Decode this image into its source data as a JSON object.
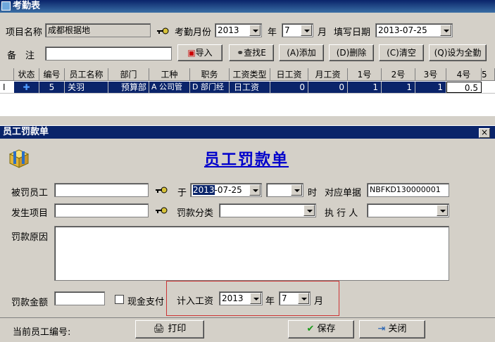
{
  "top": {
    "title": "考勤表",
    "project_label": "项目名称",
    "project_value": "成都根据地",
    "month_label": "考勤月份",
    "year_value": "2013",
    "year_unit": "年",
    "month_value": "7",
    "month_unit": "月",
    "fill_date_label": "填写日期",
    "fill_date_value": "2013-07-25",
    "remark_label": "备　注",
    "buttons": {
      "import": "导入",
      "search": "查找E",
      "add": "(A)添加",
      "delete": "(D)删除",
      "clear": "(C)清空",
      "set_all": "(Q)设为全勤"
    },
    "grid": {
      "headers": [
        "状态",
        "编号",
        "员工名称",
        "部门",
        "工种",
        "职务",
        "工资类型",
        "日工资",
        "月工资",
        "1号",
        "2号",
        "3号",
        "4号",
        "5"
      ],
      "row": {
        "indicator": "I",
        "status_icon": "plus-icon",
        "id": "5",
        "name": "关羽",
        "dept": "预算部",
        "job": "A 公司管",
        "position": "D 部门经",
        "salary_type": "日工资",
        "daily": "0",
        "monthly": "0",
        "d1": "1",
        "d2": "1",
        "d3": "1",
        "d4": "0.5"
      }
    }
  },
  "dialog": {
    "title": "员工罚款单",
    "close": "×",
    "heading": "员工罚款单",
    "employee_label": "被罚员工",
    "at_label": "于",
    "date_year_sel": "2013",
    "date_rest": "-07-25",
    "hour_label": "时",
    "doc_no_label": "对应单据",
    "doc_no_value": "NBFKD130000001",
    "item_label": "发生项目",
    "category_label": "罚款分类",
    "executor_label": "执 行 人",
    "reason_label": "罚款原因",
    "amount_label": "罚款金额",
    "cash_label": "现金支付",
    "salary_label": "计入工资",
    "salary_year": "2013",
    "year_unit": "年",
    "salary_month": "7",
    "month_unit": "月",
    "current_emp_label": "当前员工编号:",
    "print_btn": "打印",
    "save_btn": "保存",
    "close_btn": "关闭"
  },
  "colors": {
    "titlebar": "#0a246a",
    "heading": "#0000cc",
    "highlight_box": "#cc3333"
  }
}
